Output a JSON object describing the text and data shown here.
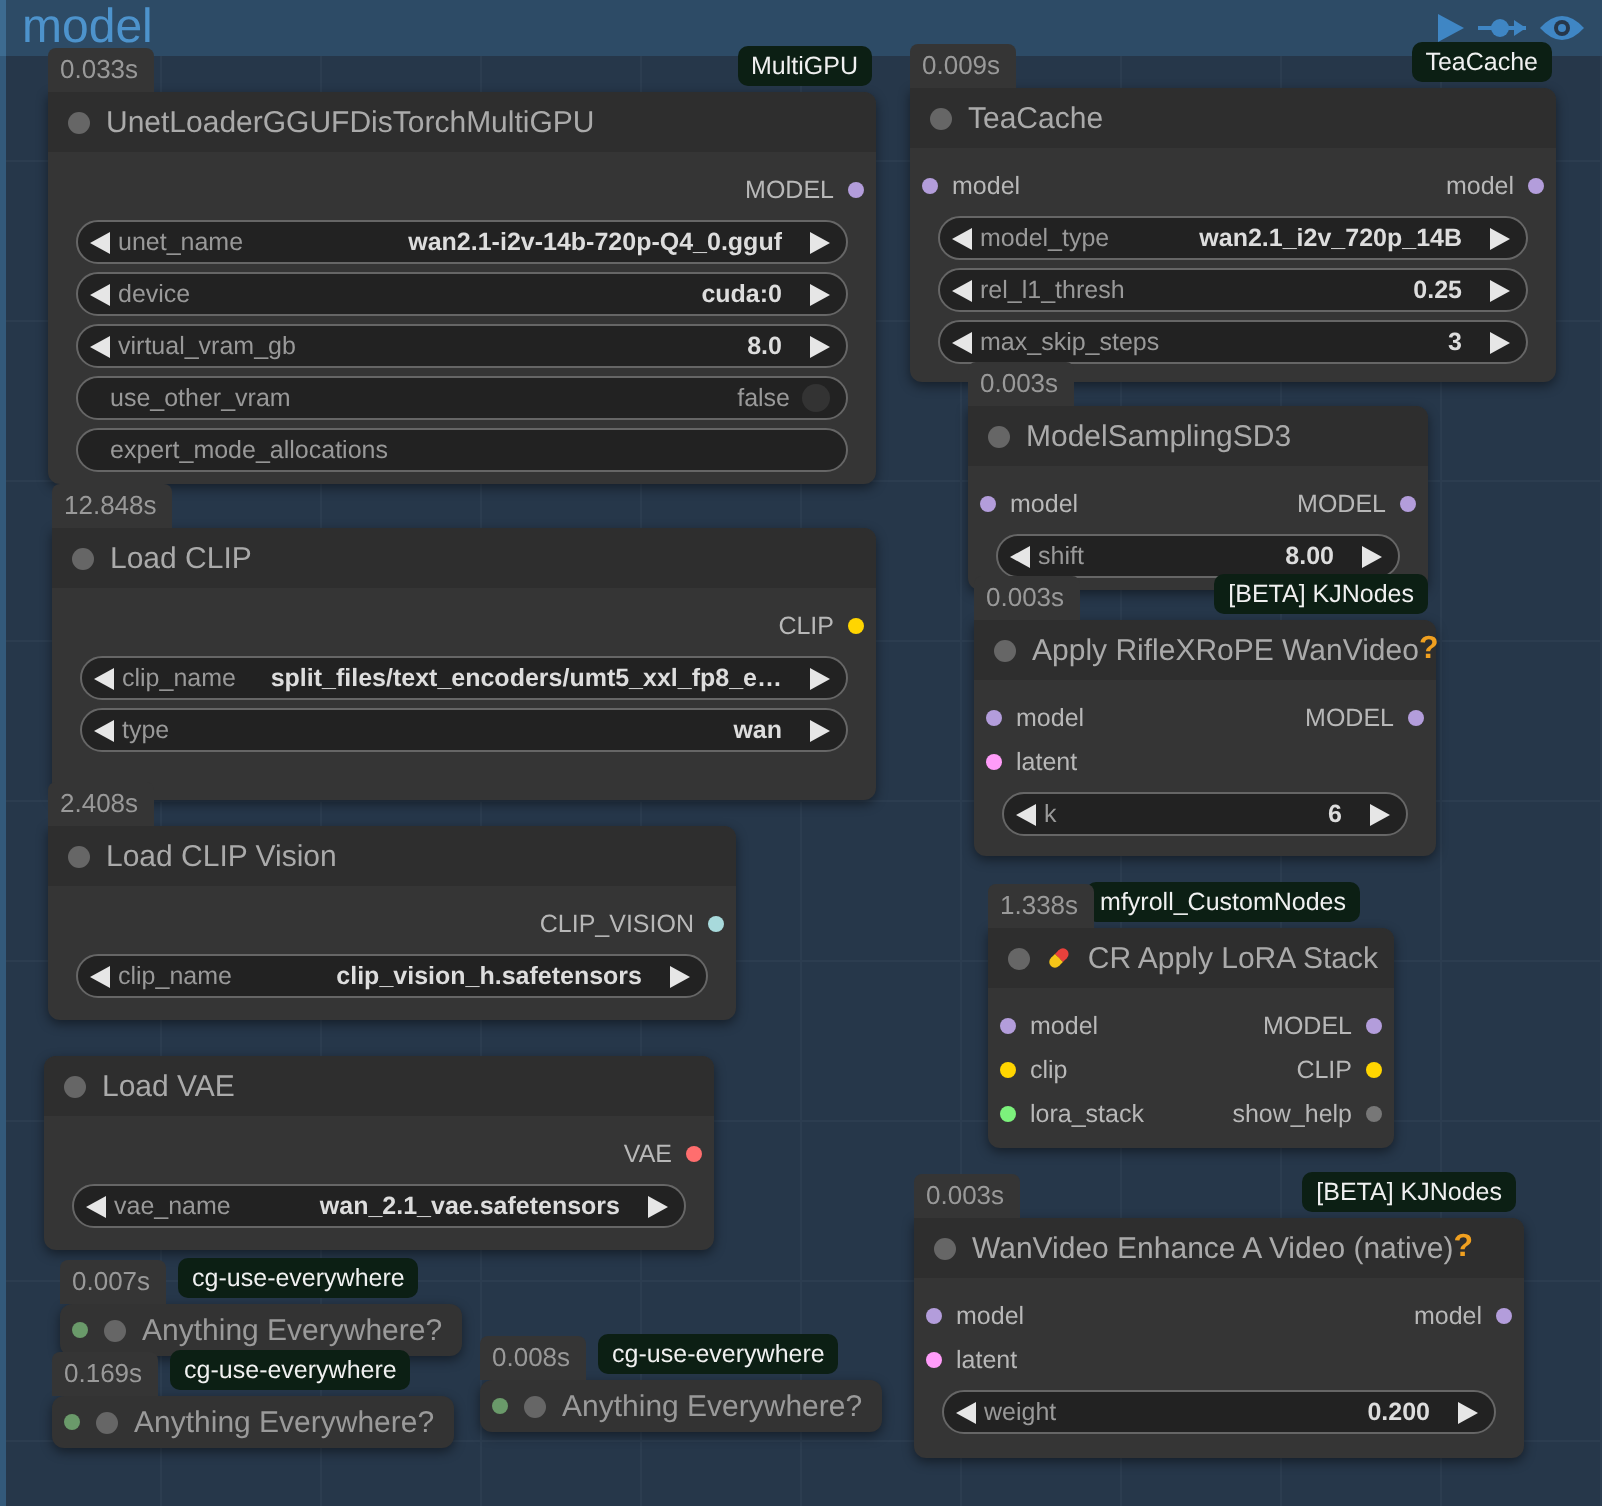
{
  "group": {
    "title": "model"
  },
  "nodes": [
    {
      "kind": "full",
      "time": "0.033s",
      "badge": "MultiGPU",
      "title": "UnetLoaderGGUFDisTorchMultiGPU",
      "rows": [
        {
          "output": {
            "label": "MODEL",
            "color": "#b39ddb"
          }
        }
      ],
      "widgets": [
        {
          "kind": "combo",
          "label": "unet_name",
          "value": "wan2.1-i2v-14b-720p-Q4_0.gguf"
        },
        {
          "kind": "combo",
          "label": "device",
          "value": "cuda:0"
        },
        {
          "kind": "combo",
          "label": "virtual_vram_gb",
          "value": "8.0"
        },
        {
          "kind": "toggle",
          "label": "use_other_vram",
          "value": "false",
          "on": false
        },
        {
          "kind": "text",
          "label": "expert_mode_allocations"
        }
      ]
    },
    {
      "kind": "full",
      "time": "12.848s",
      "title": "Load CLIP",
      "rows": [
        {
          "output": {
            "label": "CLIP",
            "color": "#ffd500"
          }
        }
      ],
      "widgets": [
        {
          "kind": "combo",
          "label": "clip_name",
          "value": "split_files/text_encoders/umt5_xxl_fp8_e…"
        },
        {
          "kind": "combo",
          "label": "type",
          "value": "wan"
        }
      ]
    },
    {
      "kind": "full",
      "time": "2.408s",
      "title": "Load CLIP Vision",
      "rows": [
        {
          "output": {
            "label": "CLIP_VISION",
            "color": "#a8dadc"
          }
        }
      ],
      "widgets": [
        {
          "kind": "combo",
          "label": "clip_name",
          "value": "clip_vision_h.safetensors"
        }
      ]
    },
    {
      "kind": "full",
      "title": "Load VAE",
      "rows": [
        {
          "output": {
            "label": "VAE",
            "color": "#ff6e6e"
          }
        }
      ],
      "widgets": [
        {
          "kind": "combo",
          "label": "vae_name",
          "value": "wan_2.1_vae.safetensors"
        }
      ]
    },
    {
      "kind": "collapsed",
      "time": "0.007s",
      "badge": "cg-use-everywhere",
      "title": "Anything Everywhere?"
    },
    {
      "kind": "collapsed",
      "time": "0.169s",
      "badge": "cg-use-everywhere",
      "title": "Anything Everywhere?"
    },
    {
      "kind": "collapsed",
      "time": "0.008s",
      "badge": "cg-use-everywhere",
      "title": "Anything Everywhere?"
    },
    {
      "kind": "full",
      "time": "0.009s",
      "badge": "TeaCache",
      "title": "TeaCache",
      "rows": [
        {
          "input": {
            "label": "model",
            "color": "#b39ddb"
          },
          "output": {
            "label": "model",
            "color": "#b39ddb"
          }
        }
      ],
      "widgets": [
        {
          "kind": "combo",
          "label": "model_type",
          "value": "wan2.1_i2v_720p_14B"
        },
        {
          "kind": "combo",
          "label": "rel_l1_thresh",
          "value": "0.25"
        },
        {
          "kind": "combo",
          "label": "max_skip_steps",
          "value": "3"
        }
      ]
    },
    {
      "kind": "full",
      "time": "0.003s",
      "title": "ModelSamplingSD3",
      "rows": [
        {
          "input": {
            "label": "model",
            "color": "#b39ddb"
          },
          "output": {
            "label": "MODEL",
            "color": "#b39ddb"
          }
        }
      ],
      "widgets": [
        {
          "kind": "combo",
          "label": "shift",
          "value": "8.00"
        }
      ]
    },
    {
      "kind": "full",
      "time": "0.003s",
      "badge": "[BETA] KJNodes",
      "title": "Apply RifleXRoPE WanVideo",
      "help": "?",
      "rows": [
        {
          "input": {
            "label": "model",
            "color": "#b39ddb"
          },
          "output": {
            "label": "MODEL",
            "color": "#b39ddb"
          }
        },
        {
          "input": {
            "label": "latent",
            "color": "#ff9cf9"
          }
        }
      ],
      "widgets": [
        {
          "kind": "combo",
          "label": "k",
          "value": "6"
        }
      ]
    },
    {
      "kind": "full",
      "time": "1.338s",
      "badge": "mfyroll_CustomNodes",
      "title": "CR Apply LoRA Stack",
      "title_icon": true,
      "rows": [
        {
          "input": {
            "label": "model",
            "color": "#b39ddb"
          },
          "output": {
            "label": "MODEL",
            "color": "#b39ddb"
          }
        },
        {
          "input": {
            "label": "clip",
            "color": "#ffd500"
          },
          "output": {
            "label": "CLIP",
            "color": "#ffd500"
          }
        },
        {
          "input": {
            "label": "lora_stack",
            "color": "#7cf27c"
          },
          "output": {
            "label": "show_help",
            "color": "#777777"
          }
        }
      ]
    },
    {
      "kind": "full",
      "time": "0.003s",
      "badge": "[BETA] KJNodes",
      "title": "WanVideo Enhance A Video (native)",
      "help": "?",
      "rows": [
        {
          "input": {
            "label": "model",
            "color": "#b39ddb"
          },
          "output": {
            "label": "model",
            "color": "#b39ddb"
          }
        },
        {
          "input": {
            "label": "latent",
            "color": "#ff9cf9"
          }
        }
      ],
      "widgets": [
        {
          "kind": "combo",
          "label": "weight",
          "value": "0.200"
        }
      ]
    }
  ]
}
